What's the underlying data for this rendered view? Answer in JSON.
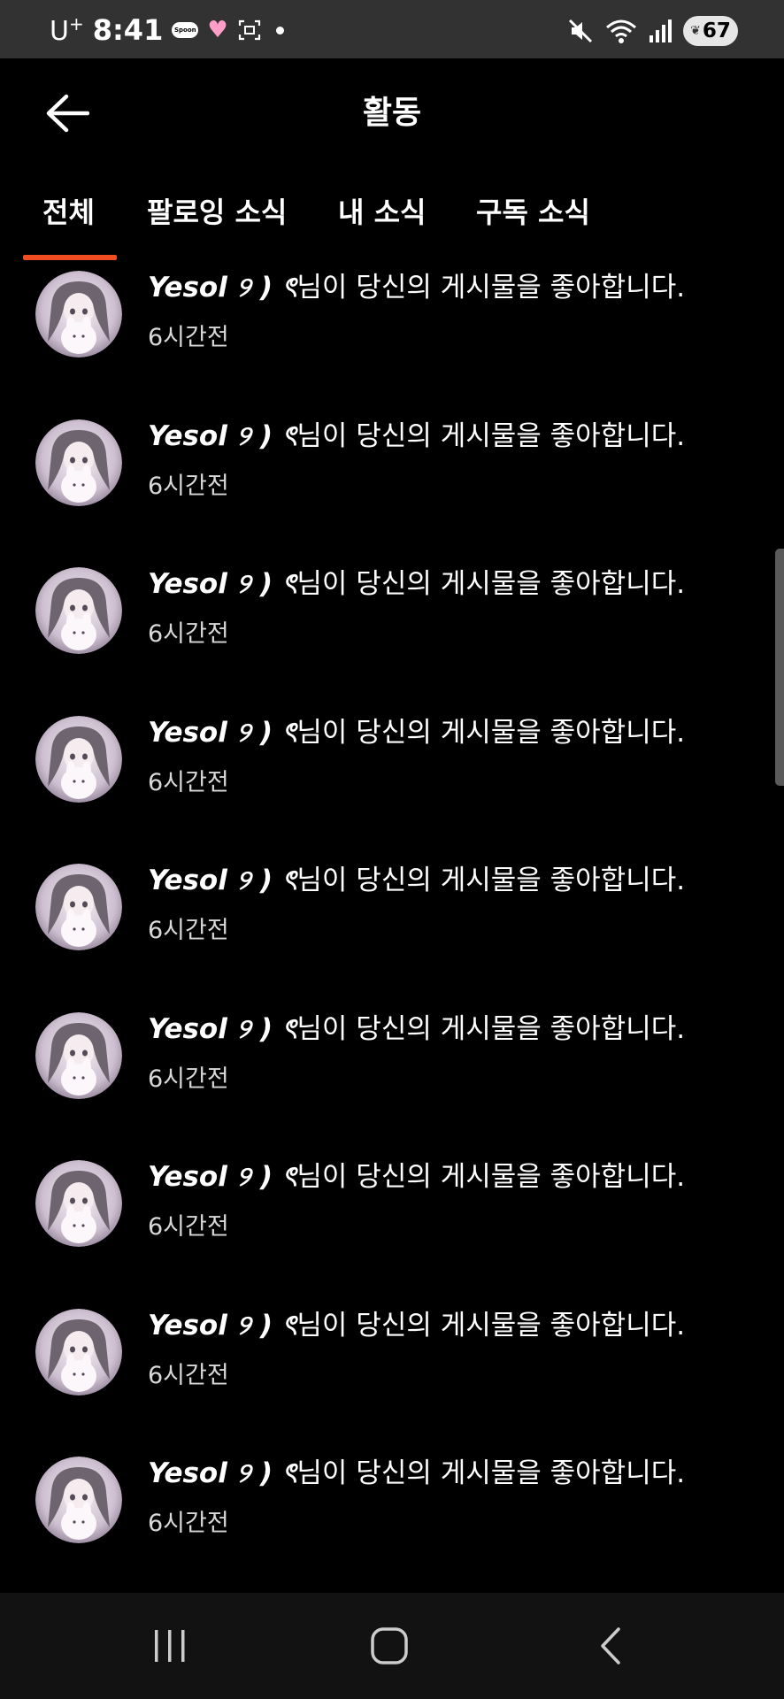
{
  "status_bar": {
    "carrier": "U",
    "carrier_sup": "+",
    "time": "8:41",
    "spoon_badge": "Spoon",
    "battery": "67"
  },
  "header": {
    "title": "활동"
  },
  "tabs": [
    {
      "label": "전체",
      "active": true
    },
    {
      "label": "팔로잉 소식",
      "active": false
    },
    {
      "label": "내 소식",
      "active": false
    },
    {
      "label": "구독 소식",
      "active": false
    }
  ],
  "activity": [
    {
      "nickname": "Yesol ୨ ) ৎ",
      "message": "님이 당신의 게시물을 좋아합니다.",
      "time": "6시간전"
    },
    {
      "nickname": "Yesol ୨ ) ৎ",
      "message": "님이 당신의 게시물을 좋아합니다.",
      "time": "6시간전"
    },
    {
      "nickname": "Yesol ୨ ) ৎ",
      "message": "님이 당신의 게시물을 좋아합니다.",
      "time": "6시간전"
    },
    {
      "nickname": "Yesol ୨ ) ৎ",
      "message": "님이 당신의 게시물을 좋아합니다.",
      "time": "6시간전"
    },
    {
      "nickname": "Yesol ୨ ) ৎ",
      "message": "님이 당신의 게시물을 좋아합니다.",
      "time": "6시간전"
    },
    {
      "nickname": "Yesol ୨ ) ৎ",
      "message": "님이 당신의 게시물을 좋아합니다.",
      "time": "6시간전"
    },
    {
      "nickname": "Yesol ୨ ) ৎ",
      "message": "님이 당신의 게시물을 좋아합니다.",
      "time": "6시간전"
    },
    {
      "nickname": "Yesol ୨ ) ৎ",
      "message": "님이 당신의 게시물을 좋아합니다.",
      "time": "6시간전"
    },
    {
      "nickname": "Yesol ୨ ) ৎ",
      "message": "님이 당신의 게시물을 좋아합니다.",
      "time": "6시간전"
    }
  ],
  "colors": {
    "accent": "#f04d22",
    "background": "#000000",
    "status_bar": "#323232",
    "nav_bar": "#121212"
  },
  "icons": {
    "back": "arrow-left-icon",
    "avatar": "avatar-anime-girl-icon",
    "nav_recent": "recent-apps-icon",
    "nav_home": "home-icon",
    "nav_back": "back-chevron-icon"
  }
}
